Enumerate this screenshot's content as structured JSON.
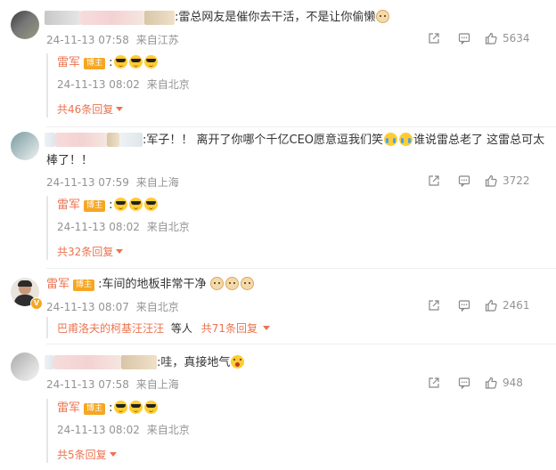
{
  "comments": [
    {
      "text": ":雷总网友是催你去干活，不是让你偷懒",
      "time": "24-11-13 07:58",
      "location": "来自江苏",
      "likes": "5634",
      "reply": {
        "name": "雷军",
        "badge": "博主",
        "text": ":",
        "time": "24-11-13 08:02",
        "location": "来自北京"
      },
      "more": "共46条回复"
    },
    {
      "text_line1": ":军子！！ 离开了你哪个千亿CEO愿意逗我们笑",
      "text_mid": "谁说雷总老了 这雷总可太",
      "text_line2": "棒了！！",
      "time": "24-11-13 07:59",
      "location": "来自上海",
      "likes": "3722",
      "reply": {
        "name": "雷军",
        "badge": "博主",
        "text": ":",
        "time": "24-11-13 08:02",
        "location": "来自北京"
      },
      "more": "共32条回复"
    },
    {
      "name": "雷军",
      "badge": "博主",
      "text": ":车间的地板非常干净",
      "time": "24-11-13 08:07",
      "location": "来自北京",
      "likes": "2461",
      "replier": "巴甫洛夫的柯基汪汪汪",
      "replier_suffix": "等人",
      "more": "共71条回复"
    },
    {
      "text": ":哇，真接地气",
      "time": "24-11-13 07:58",
      "location": "来自上海",
      "likes": "948",
      "reply": {
        "name": "雷军",
        "badge": "博主",
        "text": ":",
        "time": "24-11-13 08:02",
        "location": "来自北京"
      },
      "more": "共5条回复"
    }
  ],
  "icons": {
    "share": "share-icon",
    "reply": "comment-icon",
    "like": "thumbs-up-icon",
    "emoji_cool": "sunglasses-emoji-icon",
    "emoji_cat": "cat-face-emoji-icon",
    "emoji_cry": "crying-laughing-emoji-icon",
    "emoji_wow": "blush-emoji-icon"
  },
  "colors": {
    "accent": "#eb7350",
    "meta": "#939393",
    "badge": "#f5a623"
  }
}
